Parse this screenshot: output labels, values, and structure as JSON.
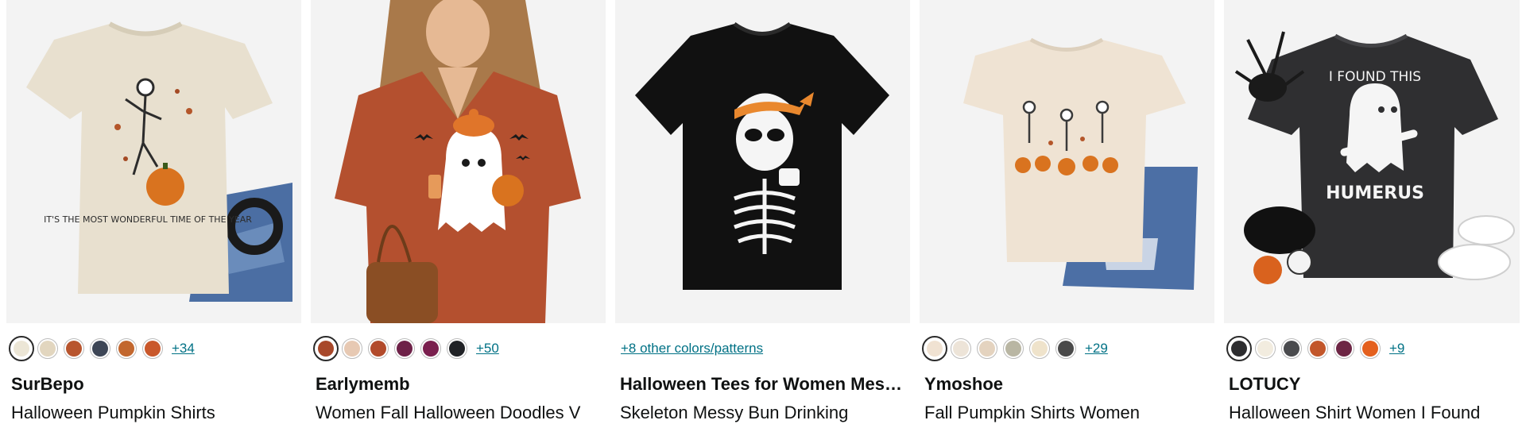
{
  "products": [
    {
      "brand": "SurBepo",
      "title": "Halloween Pumpkin Shirts",
      "shirt_color": "#e8e0cf",
      "swatches": [
        "#ece6d6",
        "#e2d6bf",
        "#b8552e",
        "#3d4656",
        "#c2672e",
        "#c9582b"
      ],
      "more": "+34"
    },
    {
      "brand": "Earlymemb",
      "title": "Women Fall Halloween Doodles V",
      "shirt_color": "#b4502f",
      "swatches": [
        "#a8482a",
        "#e7c9b3",
        "#b24a2b",
        "#6e2148",
        "#7a1f4e",
        "#202226"
      ],
      "more": "+50"
    },
    {
      "brand": "Halloween Tees for Women Messy Bun",
      "title": "Skeleton Messy Bun Drinking",
      "shirt_color": "#111111",
      "other_colors": "+8 other colors/patterns"
    },
    {
      "brand": "Ymoshoe",
      "title": "Fall Pumpkin Shirts Women",
      "shirt_color": "#efe3d3",
      "swatches": [
        "#f0e2d2",
        "#ede4d8",
        "#e4d3bf",
        "#b9b6a3",
        "#efe3cb",
        "#4a4a4a"
      ],
      "more": "+29"
    },
    {
      "brand": "LOTUCY",
      "title": "Halloween Shirt Women I Found",
      "shirt_color": "#2f2f31",
      "swatches": [
        "#2d2d2f",
        "#f2ecdf",
        "#4a4b4e",
        "#c2562a",
        "#6d2544",
        "#e4601e"
      ],
      "more": "+9"
    }
  ],
  "graphics": {
    "card1_text": "IT'S THE MOST WONDERFUL TIME OF THE YEAR",
    "card5_text_top": "I FOUND THIS",
    "card5_text_bottom": "HUMERUS"
  }
}
